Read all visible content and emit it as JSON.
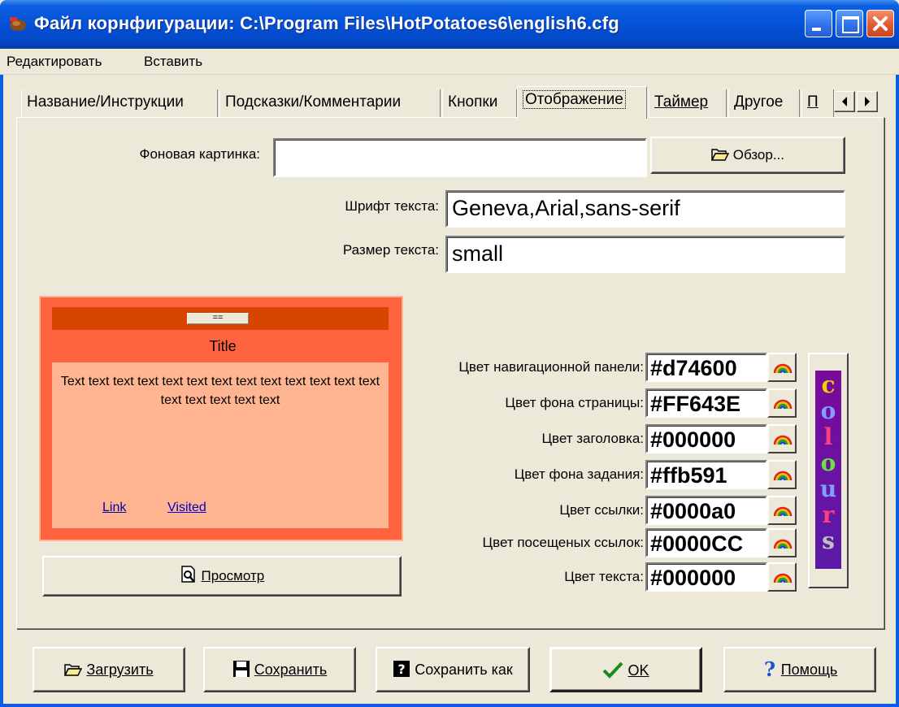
{
  "window": {
    "title": "Файл корнфигурации: C:\\Program Files\\HotPotatoes6\\english6.cfg"
  },
  "menu": {
    "edit": "Редактировать",
    "insert": "Вставить"
  },
  "tabs": [
    {
      "label": "Название/Инструкции",
      "active": false
    },
    {
      "label": "Подсказки/Комментарии",
      "active": false
    },
    {
      "label": "Кнопки",
      "active": false
    },
    {
      "label": "Отображение",
      "active": true
    },
    {
      "label": "Таймер",
      "active": false
    },
    {
      "label": "Другое",
      "active": false
    },
    {
      "label": "П",
      "active": false
    }
  ],
  "display": {
    "bg_image_label": "Фоновая картинка:",
    "bg_image_value": "",
    "browse_label": "Обзор...",
    "font_label": "Шрифт текста:",
    "font_value": "Geneva,Arial,sans-serif",
    "size_label": "Размер текста:",
    "size_value": "small"
  },
  "preview": {
    "nav_button": "==",
    "title": "Title",
    "body_text": "Text text text text text text text text text text text text text text text text text text",
    "link": "Link",
    "visited": "Visited",
    "preview_button": "Просмотр"
  },
  "colours": [
    {
      "label": "Цвет навигационной панели:",
      "value": "#d74600"
    },
    {
      "label": "Цвет фона страницы:",
      "value": "#FF643E"
    },
    {
      "label": "Цвет заголовка:",
      "value": "#000000"
    },
    {
      "label": "Цвет фона задания:",
      "value": "#ffb591"
    },
    {
      "label": "Цвет ссылки:",
      "value": "#0000a0"
    },
    {
      "label": "Цвет посещеных ссылок:",
      "value": "#0000CC"
    },
    {
      "label": "Цвет текста:",
      "value": "#000000"
    }
  ],
  "colours_button": "colours",
  "buttons": {
    "load": "Загрузить",
    "save": "Сохранить",
    "save_as": "Сохранить как",
    "ok": "OK",
    "help": "Помощь"
  },
  "icons": {
    "title": "hot-potatoes-icon",
    "browse": "folder-open-icon",
    "preview": "magnifier-page-icon",
    "colour": "rainbow-icon",
    "load": "folder-open-icon",
    "save": "floppy-disk-icon",
    "save_as": "floppy-disk-question-icon",
    "ok": "check-icon",
    "help": "question-icon"
  }
}
